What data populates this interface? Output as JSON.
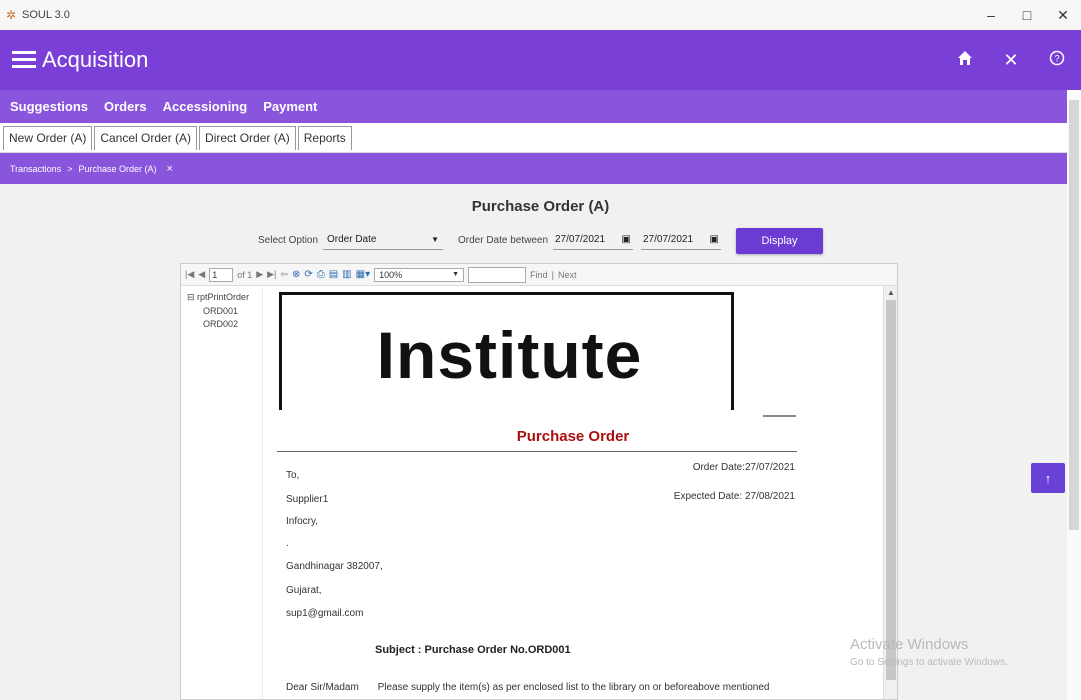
{
  "window": {
    "title": "SOUL 3.0",
    "controls": [
      "–",
      "□",
      "✕"
    ]
  },
  "appbar": {
    "title": "Acquisition",
    "icons": [
      "home-icon",
      "close-icon",
      "help-icon"
    ]
  },
  "menubar": {
    "items": [
      "Suggestions",
      "Orders",
      "Accessioning",
      "Payment"
    ]
  },
  "subtabs": {
    "items": [
      "New Order (A)",
      "Cancel Order (A)",
      "Direct Order (A)",
      "Reports"
    ]
  },
  "breadcrumb": {
    "items": [
      "Transactions",
      "Purchase Order (A)"
    ],
    "separator": ">",
    "close": "×"
  },
  "page": {
    "title": "Purchase Order (A)",
    "select_option_label": "Select Option",
    "select_option_value": "Order Date",
    "date_between_label": "Order Date between",
    "date_from": "27/07/2021",
    "date_to": "27/07/2021",
    "display_button": "Display"
  },
  "viewer": {
    "page_input": "1",
    "page_of": "of 1",
    "zoom": "100%",
    "find_label": "Find",
    "next_label": "Next",
    "docmap_root": "rptPrintOrder",
    "docmap_nodes": [
      "ORD001",
      "ORD002"
    ]
  },
  "report": {
    "logo_text": "Institute",
    "heading": "Purchase Order",
    "to": "To,",
    "supplier": "Supplier1",
    "company": "Infocry,",
    "dot_line": ".",
    "city": "Gandhinagar 382007,",
    "state": "Gujarat,",
    "email": "sup1@gmail.com",
    "order_date": "Order Date:27/07/2021",
    "expected_date": "Expected Date: 27/08/2021",
    "subject": "Subject : Purchase Order No.ORD001",
    "salutation": "Dear Sir/Madam",
    "body": "Please supply the item(s) as per enclosed list to the library on or beforeabove mentioned"
  },
  "watermark": {
    "line1": "Activate Windows",
    "line2": "Go to Settings to activate Windows."
  },
  "colors": {
    "appbar": "#7a3fd6",
    "menubar": "#8a55dd",
    "button": "#6c3bd3",
    "po_heading": "#aa1111"
  }
}
